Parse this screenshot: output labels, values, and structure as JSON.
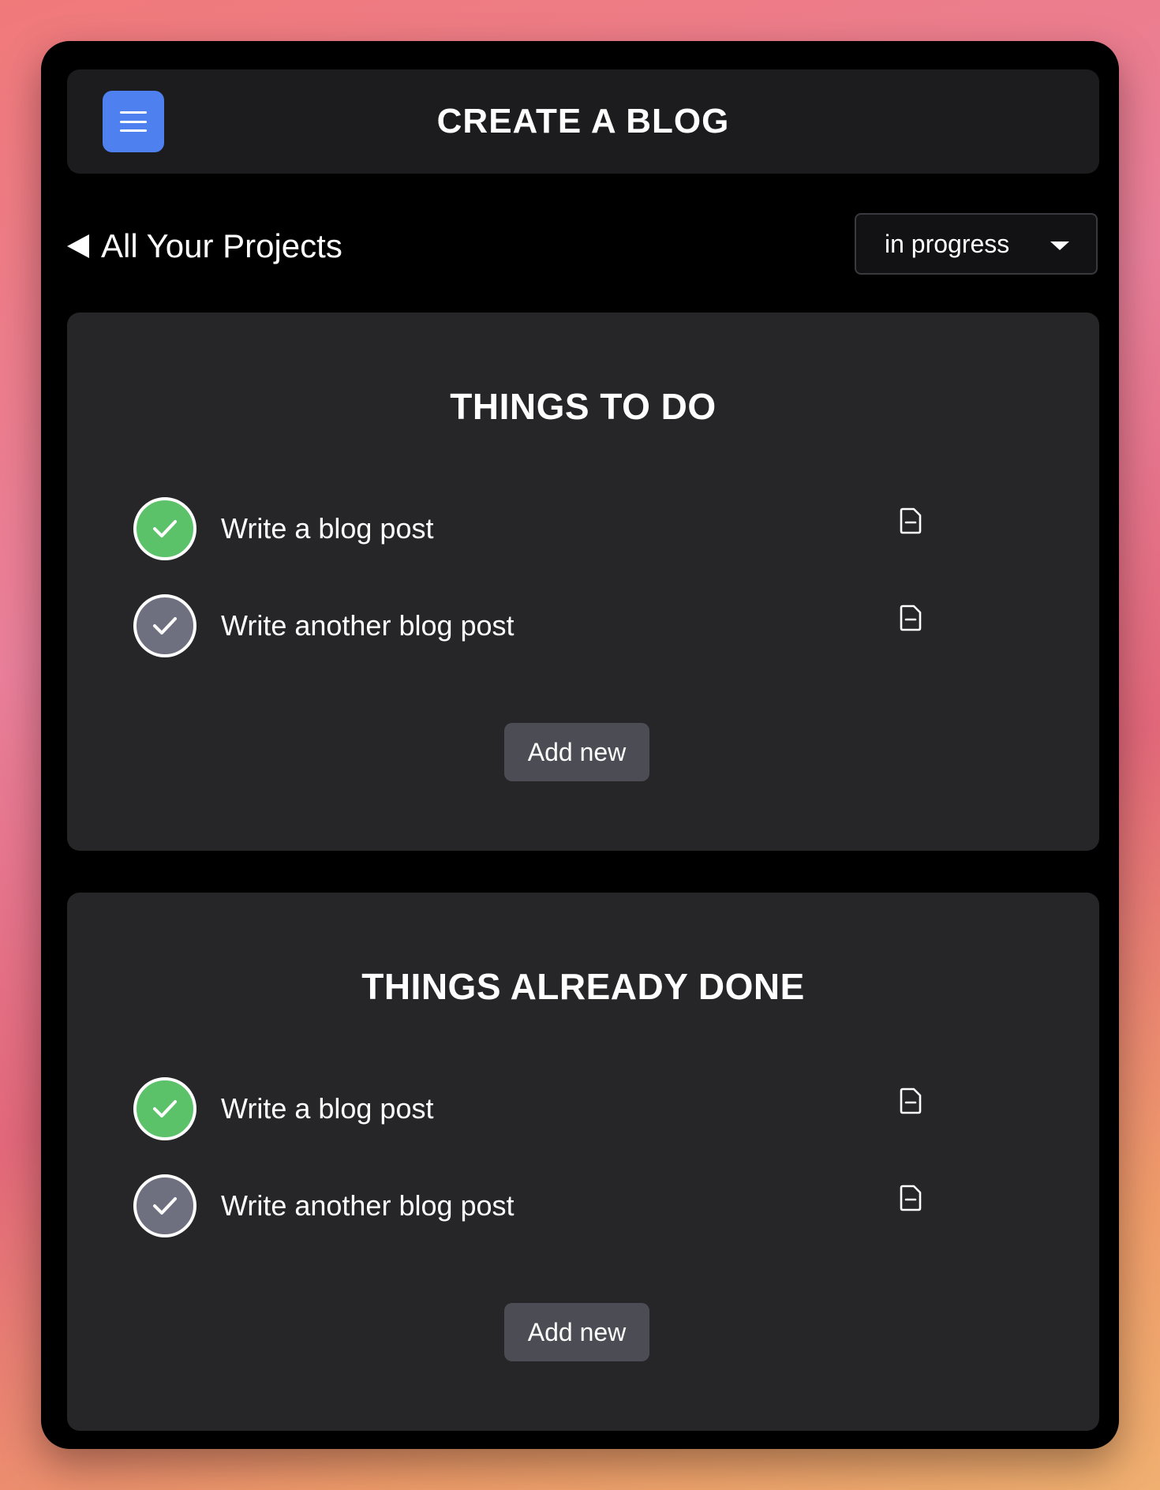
{
  "header": {
    "title": "CREATE A BLOG",
    "menu_icon": "hamburger-menu-icon"
  },
  "nav": {
    "back_label": "All Your Projects",
    "back_icon": "triangle-left-icon"
  },
  "status_select": {
    "value": "in progress",
    "icon": "caret-down-icon"
  },
  "sections": [
    {
      "title": "THINGS TO DO",
      "items": [
        {
          "label": "Write a blog post",
          "checked": true,
          "check_color": "#5bc26a",
          "icon": "document-icon"
        },
        {
          "label": "Write another blog post",
          "checked": false,
          "check_color": "#6e7080",
          "icon": "document-icon"
        }
      ],
      "add_label": "Add new"
    },
    {
      "title": "THINGS ALREADY DONE",
      "items": [
        {
          "label": "Write a blog post",
          "checked": true,
          "check_color": "#5bc26a",
          "icon": "document-icon"
        },
        {
          "label": "Write another blog post",
          "checked": false,
          "check_color": "#6e7080",
          "icon": "document-icon"
        }
      ],
      "add_label": "Add new"
    }
  ],
  "colors": {
    "accent": "#4f80f0",
    "done": "#5bc26a",
    "pending": "#6e7080",
    "panel": "#262629"
  }
}
